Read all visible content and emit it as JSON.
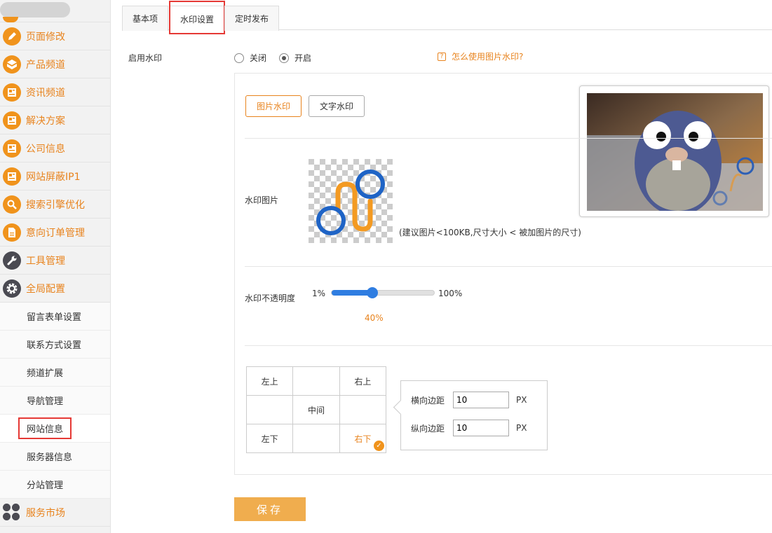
{
  "sidebar": {
    "items": [
      {
        "label": "页面修改",
        "icon": "pencil-icon"
      },
      {
        "label": "产品频道",
        "icon": "box-icon"
      },
      {
        "label": "资讯频道",
        "icon": "newspaper-icon"
      },
      {
        "label": "解决方案",
        "icon": "newspaper-icon"
      },
      {
        "label": "公司信息",
        "icon": "newspaper-icon"
      },
      {
        "label": "网站屏蔽IP1",
        "icon": "newspaper-icon"
      },
      {
        "label": "搜索引擎优化",
        "icon": "search-icon"
      },
      {
        "label": "意向订单管理",
        "icon": "document-icon"
      },
      {
        "label": "工具管理",
        "icon": "wrench-icon"
      },
      {
        "label": "全局配置",
        "icon": "gear-icon"
      }
    ],
    "subitems": [
      "留言表单设置",
      "联系方式设置",
      "频道扩展",
      "导航管理",
      "网站信息",
      "服务器信息",
      "分站管理"
    ],
    "bottom": {
      "label": "服务市场",
      "icon": "apps-icon"
    }
  },
  "tabs": [
    "基本项",
    "水印设置",
    "定时发布"
  ],
  "watermark": {
    "enable_label": "启用水印",
    "off_label": "关闭",
    "on_label": "开启",
    "help_text": "怎么使用图片水印?",
    "type_image": "图片水印",
    "type_text": "文字水印",
    "image_label": "水印图片",
    "image_hint": "(建议图片<100KB,尺寸大小 < 被加图片的尺寸)",
    "opacity_label": "水印不透明度",
    "opacity_min": "1%",
    "opacity_max": "100%",
    "opacity_value": "40%",
    "opacity_fraction": 0.4
  },
  "position_grid": {
    "top_left": "左上",
    "top_right": "右上",
    "center": "中间",
    "bottom_left": "左下",
    "bottom_right": "右下"
  },
  "margins": {
    "h_label": "横向边距",
    "h_value": "10",
    "v_label": "纵向边距",
    "v_value": "10",
    "unit": "PX"
  },
  "save_label": "保存",
  "colors": {
    "accent": "#e8831d",
    "save": "#f0ad4e",
    "slider": "#2f7de1"
  }
}
